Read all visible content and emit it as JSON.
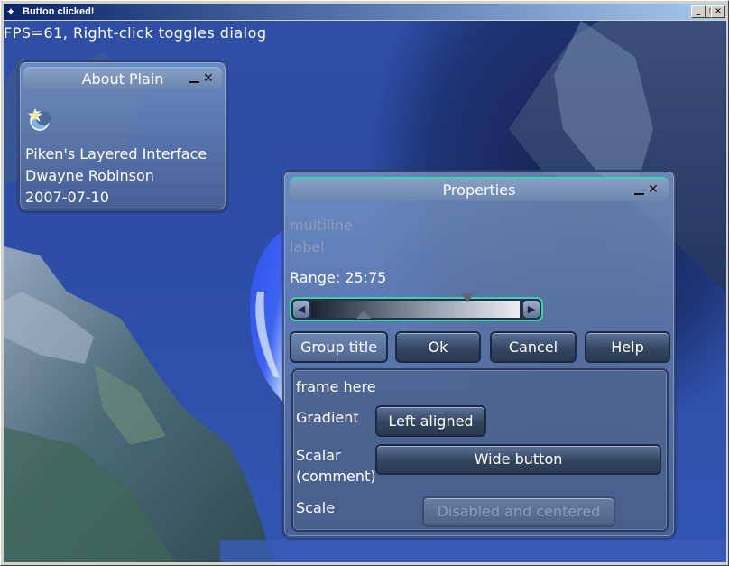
{
  "window": {
    "title": "Button clicked!",
    "icon": "app-icon",
    "controls": {
      "minimize": "_",
      "maximize": "□",
      "close": "✕"
    }
  },
  "overlay": {
    "status": "FPS=61, Right-click toggles dialog"
  },
  "about": {
    "title": "About Plain",
    "icon": "star-moon-icon",
    "lines": [
      "Piken's Layered Interface",
      "Dwayne Robinson",
      "2007-07-10"
    ]
  },
  "properties": {
    "title": "Properties",
    "multiline": [
      "multiline",
      "label"
    ],
    "range_label": "Range: 25:75",
    "range": {
      "low": 25,
      "high": 75
    },
    "buttons": {
      "group": "Group title",
      "ok": "Ok",
      "cancel": "Cancel",
      "help": "Help"
    },
    "frame": {
      "caption": "frame here",
      "rows": [
        {
          "label": "Gradient",
          "button": "Left aligned"
        },
        {
          "label": "Scalar\n(comment)",
          "label1": "Scalar",
          "label2": "(comment)",
          "button": "Wide button"
        },
        {
          "label": "Scale",
          "button": "Disabled and centered"
        }
      ]
    }
  }
}
